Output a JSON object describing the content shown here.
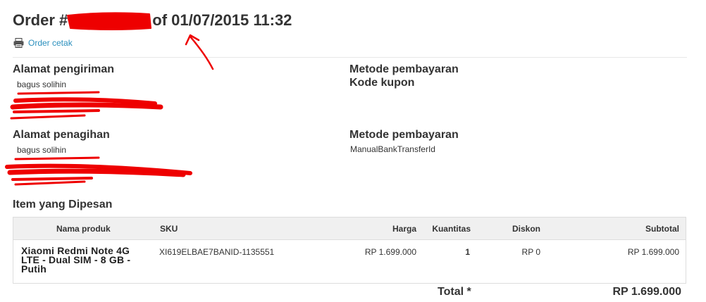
{
  "order": {
    "title_prefix": "Order #",
    "title_suffix": "of 01/07/2015 11:32"
  },
  "print_link": {
    "label": "Order cetak",
    "icon": "printer-icon"
  },
  "shipping": {
    "heading": "Alamat pengiriman",
    "name": "bagus solihin"
  },
  "payment_top": {
    "heading1": "Metode pembayaran",
    "heading2": "Kode kupon"
  },
  "billing": {
    "heading": "Alamat penagihan",
    "name": "bagus solihin"
  },
  "payment_bottom": {
    "heading": "Metode pembayaran",
    "method": "ManualBankTransferId"
  },
  "items": {
    "heading": "Item yang Dipesan",
    "columns": [
      "Nama produk",
      "SKU",
      "Harga",
      "Kuantitas",
      "Diskon",
      "Subtotal"
    ],
    "rows": [
      {
        "name": "Xiaomi Redmi Note 4G LTE - Dual SIM - 8 GB - Putih",
        "sku": "XI619ELBAE7BANID-1135551",
        "price": "RP 1.699.000",
        "qty": "1",
        "discount": "RP 0",
        "subtotal": "RP 1.699.000"
      }
    ]
  },
  "total": {
    "label": "Total *",
    "value": "RP 1.699.000"
  },
  "colors": {
    "link": "#2a8fbd",
    "redaction": "#ee0000",
    "header_bg": "#f0f0f0"
  }
}
